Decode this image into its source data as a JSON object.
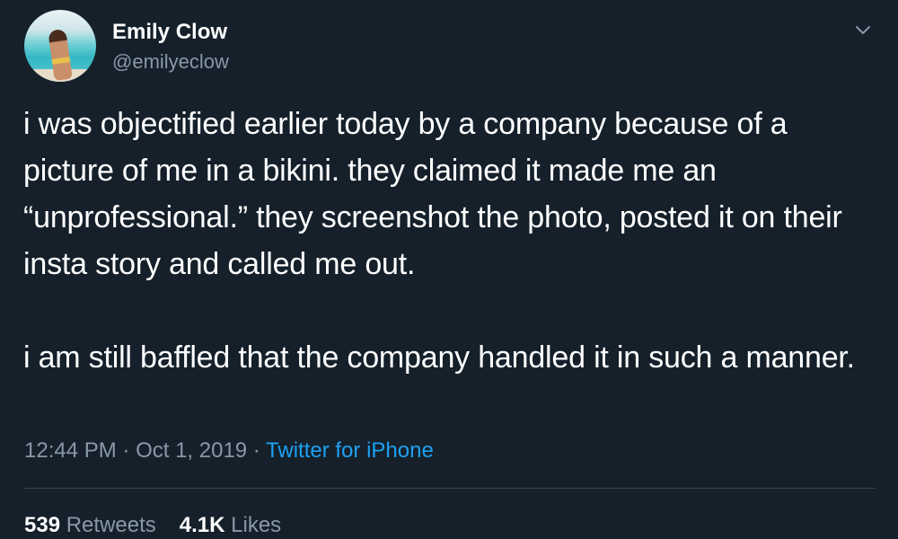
{
  "user": {
    "display_name": "Emily Clow",
    "handle": "@emilyeclow"
  },
  "tweet": {
    "paragraph1": "i was objectified earlier today by a company because of a picture of me in a bikini. they claimed it made me an “unprofessional.” they screenshot the photo, posted it on their insta story and called me out.",
    "paragraph2": "i am still baffled that the company handled it in such a manner."
  },
  "meta": {
    "time": "12:44 PM",
    "separator1": " · ",
    "date": "Oct 1, 2019",
    "separator2": " · ",
    "source": "Twitter for iPhone"
  },
  "stats": {
    "retweets_count": "539",
    "retweets_label": "Retweets",
    "likes_count": "4.1K",
    "likes_label": "Likes"
  },
  "icons": {
    "menu": "chevron-down-icon"
  },
  "colors": {
    "background": "#15202b",
    "text": "#ffffff",
    "secondary": "#8899a6",
    "link": "#1da1f2",
    "divider": "#38444d"
  }
}
